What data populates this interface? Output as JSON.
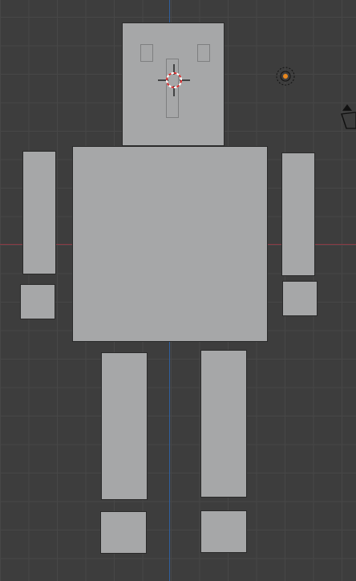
{
  "viewport": {
    "view": "front-orthographic",
    "grid": true,
    "colors": {
      "background": "#3d3d3d",
      "grid_line": "#474747",
      "x_axis": "#8a3a44",
      "z_axis": "#2f5f9e",
      "mesh": "#a6a7a8",
      "lamp_center": "#e8871e"
    }
  },
  "scene": {
    "objects": [
      {
        "name": "head",
        "type": "mesh"
      },
      {
        "name": "torso",
        "type": "mesh"
      },
      {
        "name": "left-arm",
        "type": "mesh"
      },
      {
        "name": "right-arm",
        "type": "mesh"
      },
      {
        "name": "left-hand",
        "type": "mesh"
      },
      {
        "name": "right-hand",
        "type": "mesh"
      },
      {
        "name": "left-leg",
        "type": "mesh"
      },
      {
        "name": "right-leg",
        "type": "mesh"
      },
      {
        "name": "left-foot",
        "type": "mesh"
      },
      {
        "name": "right-foot",
        "type": "mesh"
      },
      {
        "name": "light",
        "type": "point-light",
        "icon": "lamp-icon"
      },
      {
        "name": "camera",
        "type": "camera",
        "icon": "camera-icon"
      }
    ],
    "cursor_icon": "3d-cursor-icon"
  }
}
